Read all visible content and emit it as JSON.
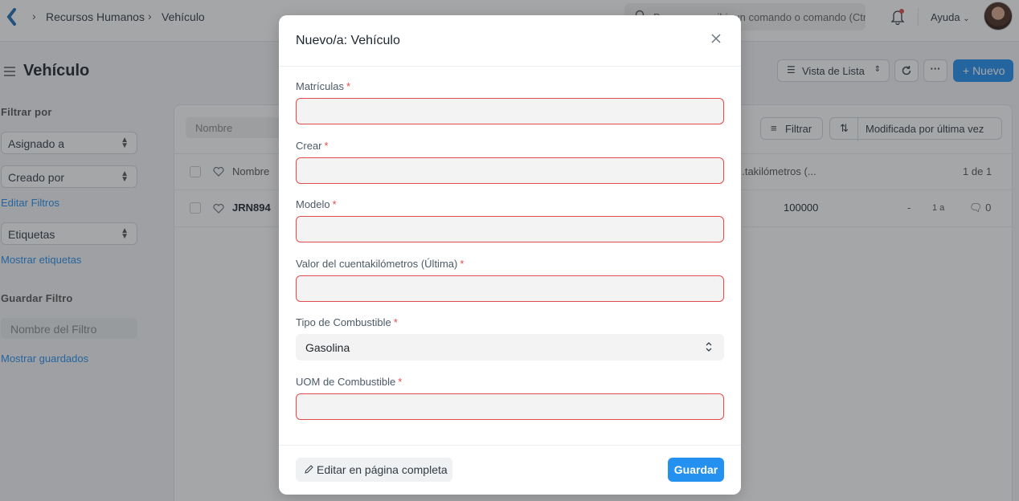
{
  "navbar": {
    "breadcrumbs": [
      "Recursos Humanos",
      "Vehículo"
    ],
    "search_text": "Buscar o escribir un comando o comando (Ctrl + G)",
    "help_label": "Ayuda"
  },
  "page": {
    "title": "Vehículo",
    "list_view_label": "Vista de Lista",
    "more_label": "···",
    "new_label": "+ Nuevo"
  },
  "sidebar": {
    "filter_by_label": "Filtrar por",
    "assigned_to": "Asignado a",
    "created_by": "Creado por",
    "edit_filters": "Editar Filtros",
    "tags": "Etiquetas",
    "show_tags": "Mostrar etiquetas",
    "save_filter_label": "Guardar Filtro",
    "filter_name_placeholder": "Nombre del Filtro",
    "show_saved": "Mostrar guardados"
  },
  "list": {
    "name_filter_placeholder": "Nombre",
    "filter_label": "Filtrar",
    "sort_label": "Modificada por última vez",
    "header_name": "Nombre",
    "header_odometer": "...takilómetros (...",
    "count": "1 de 1",
    "rows": [
      {
        "name": "JRN894",
        "odometer": "100000",
        "dash": "-",
        "age": "1 a",
        "comments": "0"
      }
    ]
  },
  "modal": {
    "title": "Nuevo/a: Vehículo",
    "fields": [
      {
        "label": "Matrículas",
        "value": ""
      },
      {
        "label": "Crear",
        "value": ""
      },
      {
        "label": "Modelo",
        "value": ""
      },
      {
        "label": "Valor del cuentakilómetros (Última)",
        "value": ""
      },
      {
        "label": "Tipo de Combustible",
        "value": "Gasolina"
      },
      {
        "label": "UOM de Combustible",
        "value": ""
      }
    ],
    "required_mark": "*",
    "full_page_label": "Editar en página completa",
    "save_label": "Guardar"
  },
  "colors": {
    "primary": "#2490ef",
    "required": "#e24c4c"
  }
}
